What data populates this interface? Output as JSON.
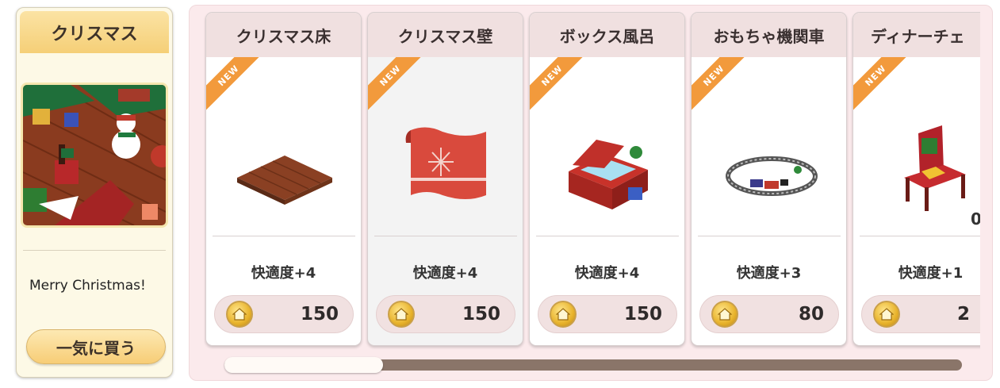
{
  "set_panel": {
    "title": "クリスマス",
    "description": "Merry Christmas!",
    "buy_all_label": "一気に買う"
  },
  "new_badge": "NEW",
  "items": [
    {
      "name": "クリスマス床",
      "comfort": "快適度+4",
      "price": "150",
      "icon": "christmas-floor-icon"
    },
    {
      "name": "クリスマス壁",
      "comfort": "快適度+4",
      "price": "150",
      "icon": "christmas-wall-icon"
    },
    {
      "name": "ボックス風呂",
      "comfort": "快適度+4",
      "price": "150",
      "icon": "box-bath-icon"
    },
    {
      "name": "おもちゃ機関車",
      "comfort": "快適度+3",
      "price": "80",
      "icon": "toy-train-icon"
    },
    {
      "name": "ディナーチェ",
      "comfort": "快適度+1",
      "price": "2",
      "icon": "dinner-chair-icon",
      "edge_digit": "0"
    }
  ],
  "currency_icon": "house-coin-icon",
  "scroll_position": 0.0,
  "colors": {
    "badge": "#f29a3c",
    "card_header": "#f0e0e0",
    "price_pill": "#f1e1e1",
    "scroll_track": "#8a7569"
  }
}
